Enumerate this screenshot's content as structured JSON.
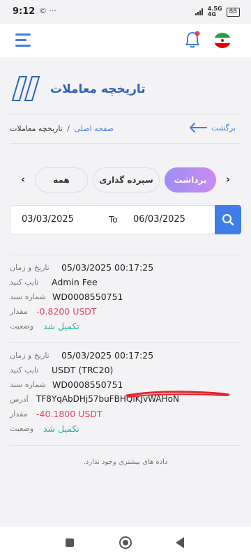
{
  "status": {
    "time": "9:12",
    "left_icons": "© ···",
    "network": "4.5G",
    "network_sub": "4G",
    "battery": "88"
  },
  "page": {
    "title": "تاریخچه معاملات"
  },
  "breadcrumb": {
    "home": "صفحه اصلی",
    "separator": "/",
    "current": "تاریخچه معاملات",
    "back_label": "برگشت"
  },
  "tabs": {
    "prev_arrow": "‹",
    "next_arrow": "›",
    "all": "همه",
    "deposit": "سپرده گذاری",
    "withdraw": "برداشت",
    "active": "withdraw"
  },
  "filter": {
    "from_date": "03/03/2025",
    "to_label": "To",
    "to_date": "06/03/2025"
  },
  "labels": {
    "datetime": "تاریخ و زمان",
    "type": "تایپ کنید",
    "doc_number": "شماره سند",
    "address": "آدرس",
    "amount": "مقدار",
    "status": "وضعیت"
  },
  "records": [
    {
      "datetime": "05/03/2025 00:17:25",
      "type": "Admin Fee",
      "doc_number": "WD0008550751",
      "amount": "-0.8200 USDT",
      "status": "تکمیل شد"
    },
    {
      "datetime": "05/03/2025 00:17:25",
      "type": "USDT (TRC20)",
      "doc_number": "WD0008550751",
      "address": "TF8YqAbDHj57buFBHQiKJvWAHoN",
      "amount": "-40.1800 USDT",
      "status": "تکمیل شد"
    }
  ],
  "footer": {
    "no_more": "داده های بیشتری وجود ندارد."
  },
  "colors": {
    "accent": "#3f7ee8",
    "title": "#2f62b8",
    "negative": "#e0435a",
    "success": "#27b39a"
  }
}
